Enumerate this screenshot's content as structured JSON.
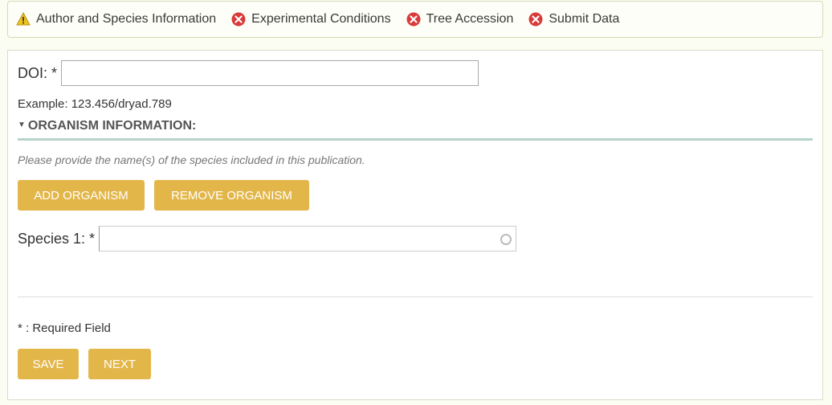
{
  "steps": [
    {
      "label": "Author and Species Information",
      "status": "warning"
    },
    {
      "label": "Experimental Conditions",
      "status": "error"
    },
    {
      "label": "Tree Accession",
      "status": "error"
    },
    {
      "label": "Submit Data",
      "status": "error"
    }
  ],
  "colors": {
    "warning": "#f0c419",
    "error": "#d93a3a",
    "button": "#e3b64a",
    "divider": "#b8d4c9"
  },
  "form": {
    "doi_label": "DOI: *",
    "doi_value": "",
    "example": "Example: 123.456/dryad.789",
    "organism_heading": "ORGANISM INFORMATION:",
    "organism_note": "Please provide the name(s) of the species included in this publication.",
    "add_organism": "ADD ORGANISM",
    "remove_organism": "REMOVE ORGANISM",
    "species_label": "Species 1: *",
    "species_value": "",
    "required_note": "* : Required Field",
    "save": "SAVE",
    "next": "NEXT"
  }
}
